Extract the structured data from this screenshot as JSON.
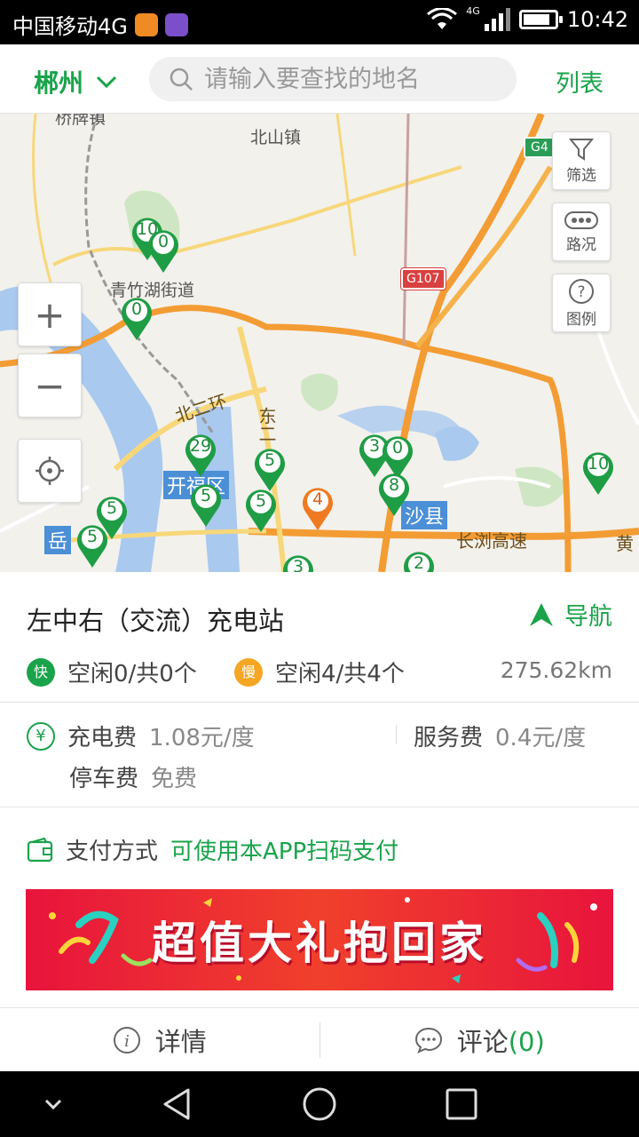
{
  "status_bar": {
    "carrier": "中国移动4G",
    "network": "4G",
    "time": "10:42",
    "battery_level": 0.85
  },
  "header": {
    "city": "郴州",
    "search_placeholder": "请输入要查找的地名",
    "list_label": "列表"
  },
  "map": {
    "labels": {
      "town_top": "北山镇",
      "town_topleft": "桥牌镇",
      "street": "青竹湖街道",
      "ring": "北二环",
      "east": "东二",
      "district": "开福区",
      "county": "沙县",
      "expressway": "长浏高速",
      "g107": "G107",
      "g4": "G4",
      "yue": "岳",
      "huang": "黄"
    },
    "pins": [
      "10",
      "0",
      "0",
      "29",
      "5",
      "5",
      "5",
      "5",
      "3",
      "0",
      "8",
      "4",
      "10",
      "5",
      "3",
      "2"
    ],
    "controls": {
      "filter": "筛选",
      "traffic": "路况",
      "legend": "图例",
      "zoom_in": "+",
      "zoom_out": "−"
    }
  },
  "station": {
    "name": "左中右（交流）充电站",
    "nav_label": "导航",
    "fast_badge": "快",
    "fast_status": "空闲0/共0个",
    "slow_badge": "慢",
    "slow_status": "空闲4/共4个",
    "distance": "275.62km",
    "yen_symbol": "¥",
    "charge_fee_label": "充电费",
    "charge_fee_value": "1.08元/度",
    "service_fee_label": "服务费",
    "service_fee_value": "0.4元/度",
    "parking_fee_label": "停车费",
    "parking_fee_value": "免费",
    "pay_label": "支付方式",
    "pay_value": "可使用本APP扫码支付",
    "banner_text": "超值大礼抱回家"
  },
  "bottom_tabs": {
    "details": "详情",
    "comments": "评论",
    "comment_count": "(0)"
  },
  "colors": {
    "accent": "#1aa34a",
    "slow": "#f5a623",
    "banner": "#e8143c"
  }
}
